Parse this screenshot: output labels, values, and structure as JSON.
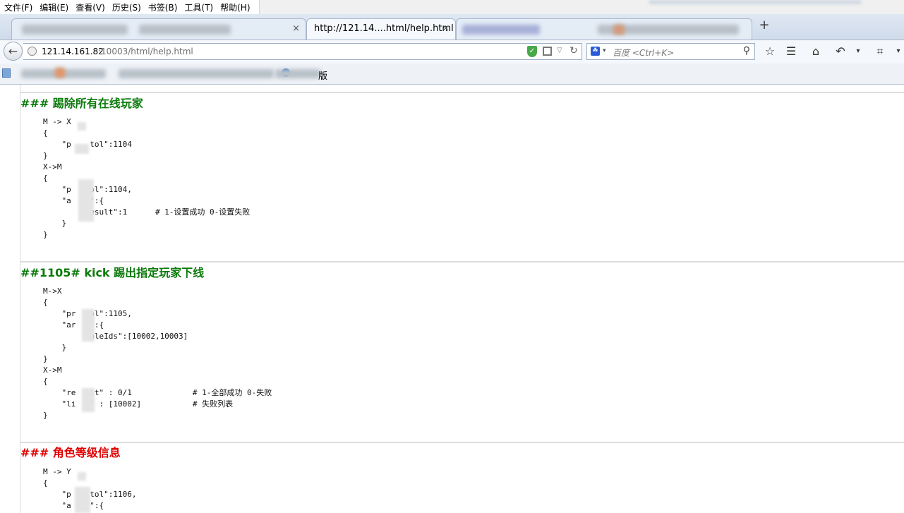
{
  "menubar": {
    "items": [
      "文件(F)",
      "编辑(E)",
      "查看(V)",
      "历史(S)",
      "书签(B)",
      "工具(T)",
      "帮助(H)"
    ]
  },
  "tabs": {
    "active_title": "http://121.14....html/help.html",
    "close_glyph": "×",
    "new_tab_glyph": "+"
  },
  "navbar": {
    "url_host": "121.14.161.82",
    "url_rest": ":10003/html/help.html",
    "search_placeholder": "百度 <Ctrl+K>"
  },
  "bookmarks": {
    "visible_label": "版"
  },
  "content": {
    "sections": [
      {
        "title": "### 踢除所有在线玩家",
        "color": "#0b7a0b",
        "code": "M -> X\n{\n    \"p    tol\":1104\n}\nX->M\n{\n    \"p    ol\":1104,\n    \"a    \":{\n         result\":1      # 1-设置成功 0-设置失败\n    }\n}"
      },
      {
        "title": "##1105# kick 踢出指定玩家下线",
        "color": "#0b7a0b",
        "code": "M->X\n{\n    \"pr   ol\":1105,\n    \"ar   \":{\n         roleIds\":[10002,10003]\n    }\n}\nX->M\n{\n    \"re   lt\" : 0/1             # 1-全部成功 0-失败\n    \"li   \" : [10002]           # 失败列表\n}"
      },
      {
        "title": "### 角色等级信息",
        "color": "#e00000",
        "code": "M -> Y\n{\n    \"p    tol\":1106,\n    \"a    \":{"
      }
    ]
  }
}
